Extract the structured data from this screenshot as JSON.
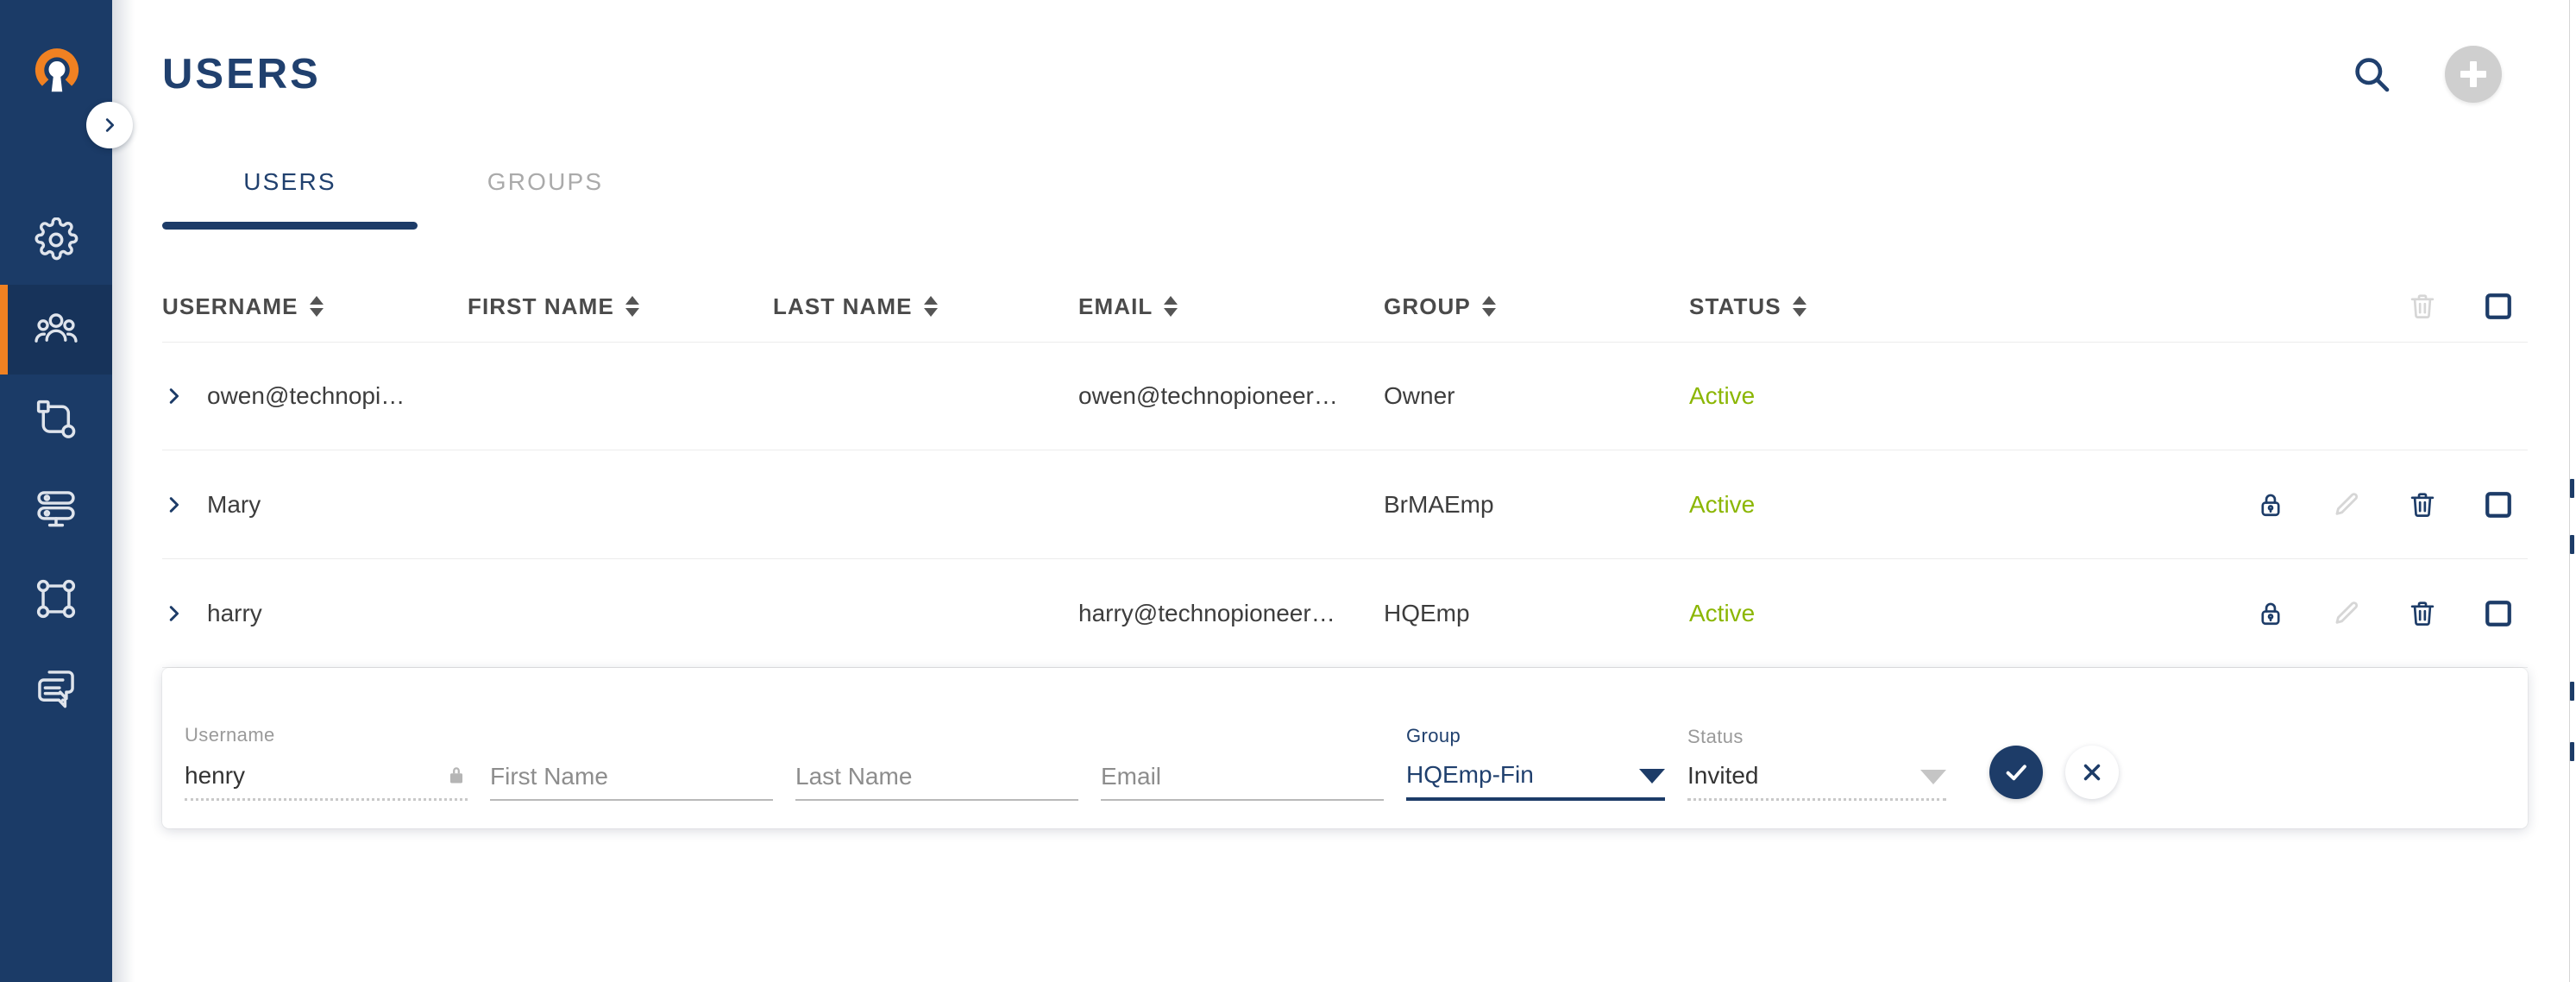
{
  "brand": {
    "logo_name": "openvpn-logo",
    "logo_arc_color": "#f08122",
    "logo_key_color": "#ffffff",
    "sidebar_bg": "#1b3b67",
    "sidebar_active_bg": "#17335a",
    "accent_orange": "#f08122",
    "navy": "#1d3c68",
    "status_green": "#8bb603"
  },
  "sidebar": {
    "collapse_icon": "chevron-right-icon",
    "items": [
      {
        "icon": "gear-icon",
        "name": "settings",
        "active": false
      },
      {
        "icon": "users-icon",
        "name": "users",
        "active": true
      },
      {
        "icon": "network-icon",
        "name": "network",
        "active": false
      },
      {
        "icon": "servers-icon",
        "name": "servers",
        "active": false
      },
      {
        "icon": "topology-icon",
        "name": "topology",
        "active": false
      },
      {
        "icon": "chat-icon",
        "name": "messages",
        "active": false
      }
    ]
  },
  "header": {
    "title": "USERS",
    "search_icon": "search-icon",
    "add_icon": "plus-icon",
    "add_enabled": false
  },
  "tabs": [
    {
      "label": "USERS",
      "active": true
    },
    {
      "label": "GROUPS",
      "active": false
    }
  ],
  "table": {
    "columns": [
      {
        "label": "USERNAME",
        "sortable": true
      },
      {
        "label": "FIRST NAME",
        "sortable": true
      },
      {
        "label": "LAST NAME",
        "sortable": true
      },
      {
        "label": "EMAIL",
        "sortable": true
      },
      {
        "label": "GROUP",
        "sortable": true
      },
      {
        "label": "STATUS",
        "sortable": true
      }
    ],
    "header_actions": [
      {
        "icon": "trash-icon",
        "name": "delete-selected",
        "enabled": false
      },
      {
        "icon": "checkbox-icon",
        "name": "select-all",
        "checked": false
      }
    ],
    "rows": [
      {
        "username": "owen@technopi…",
        "first_name": "",
        "last_name": "",
        "email": "owen@technopioneer…",
        "group": "Owner",
        "status": "Active",
        "show_actions": false
      },
      {
        "username": "Mary",
        "first_name": "",
        "last_name": "",
        "email": "",
        "group": "BrMAEmp",
        "status": "Active",
        "show_actions": true
      },
      {
        "username": "harry",
        "first_name": "",
        "last_name": "",
        "email": "harry@technopioneer…",
        "group": "HQEmp",
        "status": "Active",
        "show_actions": true
      }
    ],
    "row_action_icons": [
      "lock-icon",
      "pencil-icon",
      "trash-icon",
      "checkbox-icon"
    ]
  },
  "edit_row": {
    "username": {
      "label": "Username",
      "value": "henry",
      "locked": true,
      "lock_icon": "lock-icon",
      "state": "disabled"
    },
    "first_name": {
      "label": "",
      "placeholder": "First Name",
      "value": "",
      "state": "empty"
    },
    "last_name": {
      "label": "",
      "placeholder": "Last Name",
      "value": "",
      "state": "empty"
    },
    "email": {
      "label": "",
      "placeholder": "Email",
      "value": "",
      "state": "empty"
    },
    "group": {
      "label": "Group",
      "value": "HQEmp-Fin",
      "state": "focused",
      "caret_icon": "chevron-down-icon"
    },
    "status": {
      "label": "Status",
      "value": "Invited",
      "state": "disabled",
      "caret_icon": "chevron-down-icon"
    },
    "confirm": {
      "icon": "check-icon",
      "name": "confirm"
    },
    "cancel": {
      "icon": "close-icon",
      "name": "cancel"
    }
  }
}
